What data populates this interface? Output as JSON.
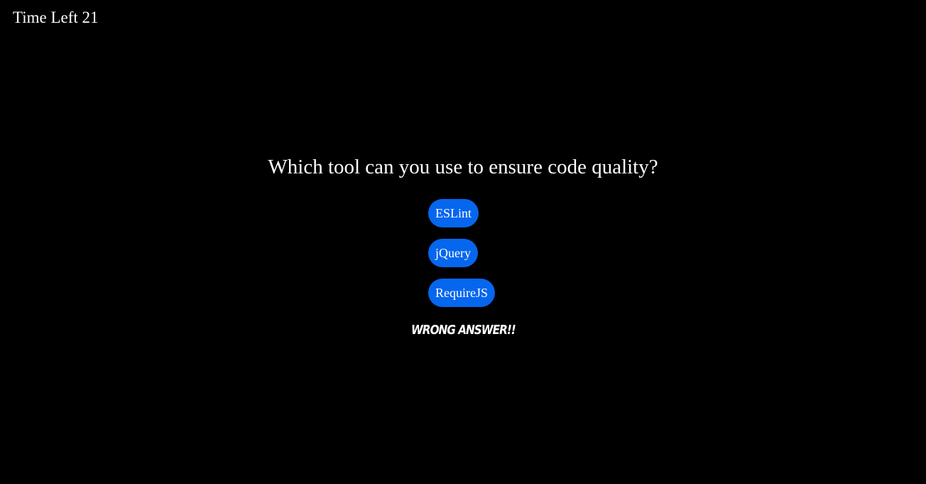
{
  "timer": {
    "label": "Time Left 21"
  },
  "quiz": {
    "question": "Which tool can you use to ensure code quality?",
    "choices": [
      {
        "label": "ESLint"
      },
      {
        "label": "jQuery"
      },
      {
        "label": "RequireJS"
      }
    ],
    "feedback": "WRONG ANSWER!!"
  },
  "colors": {
    "background": "#000000",
    "button": "#0566ee",
    "text": "#ffffff"
  }
}
